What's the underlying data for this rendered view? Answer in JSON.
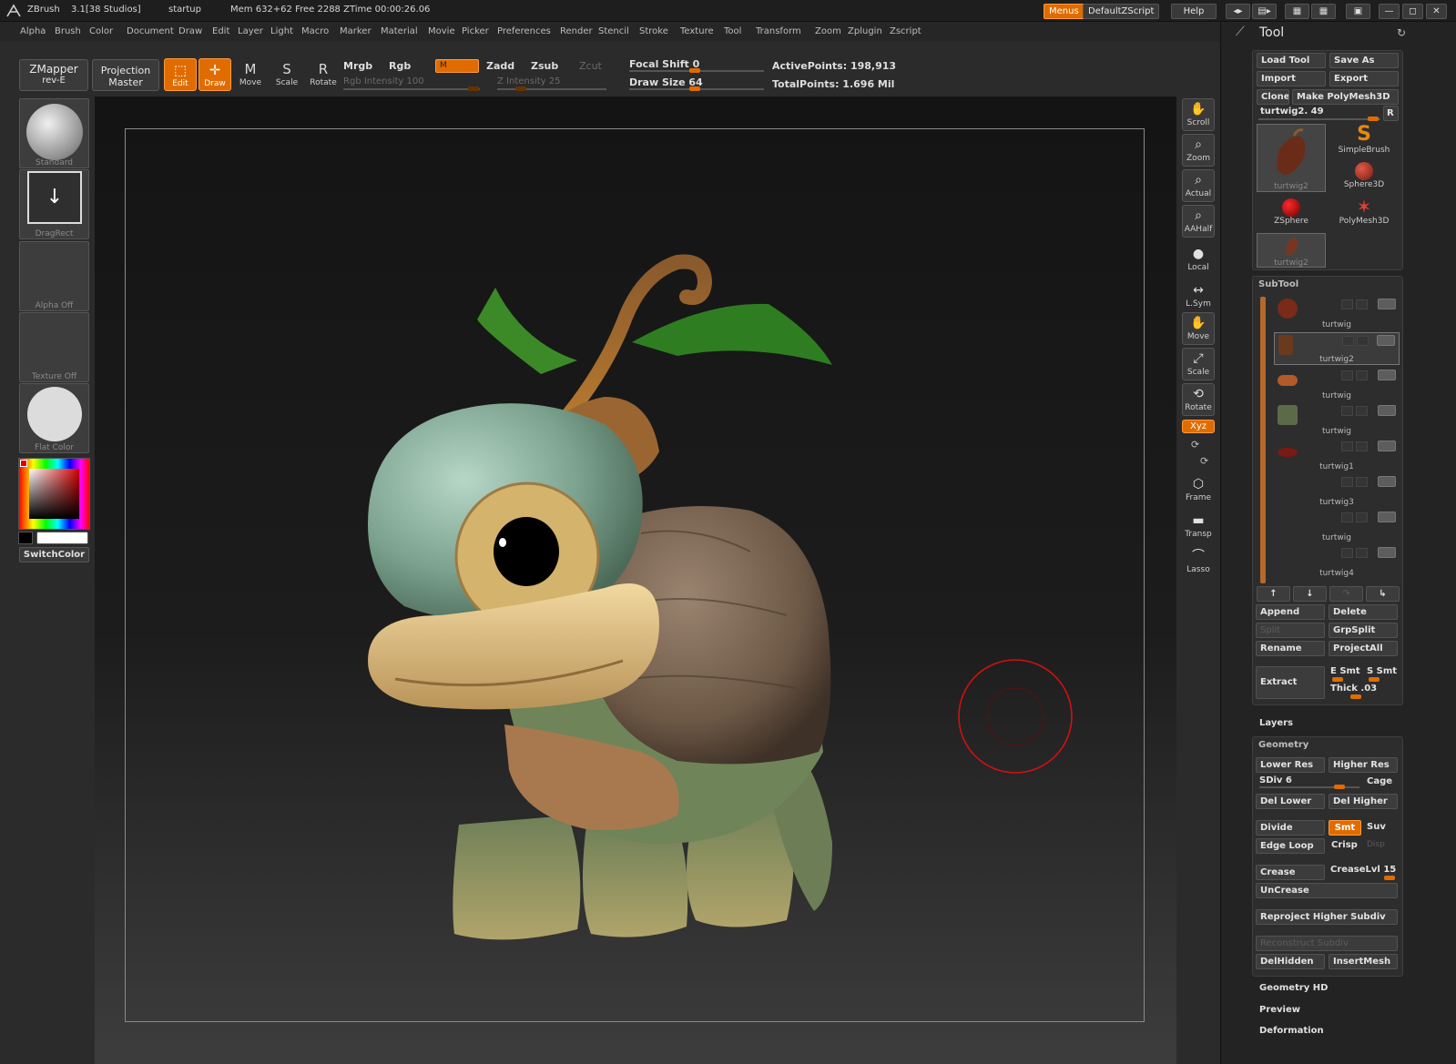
{
  "titlebar": {
    "app": "ZBrush",
    "version": "3.1[38 Studios]",
    "document": "startup",
    "memory": "Mem 632+62  Free 2288  ZTime 00:00:26.06",
    "menus_btn": "Menus",
    "script_btn": "DefaultZScript",
    "help_btn": "Help"
  },
  "menubar": [
    "Alpha",
    "Brush",
    "Color",
    "Document",
    "Draw",
    "Edit",
    "Layer",
    "Light",
    "Macro",
    "Marker",
    "Material",
    "Movie",
    "Picker",
    "Preferences",
    "Render",
    "Stencil",
    "Stroke",
    "Texture",
    "Tool",
    "Transform",
    "Zoom",
    "Zplugin",
    "Zscript"
  ],
  "shelf": {
    "zmapper": "ZMapper",
    "zmapper_sub": "rev-E",
    "projection": "Projection",
    "projection_sub": "Master",
    "edit": "Edit",
    "draw": "Draw",
    "move": "Move",
    "scale": "Scale",
    "rotate": "Rotate",
    "mrgb": "Mrgb",
    "rgb": "Rgb",
    "m": "M",
    "zadd": "Zadd",
    "zsub": "Zsub",
    "zcut": "Zcut",
    "rgb_intensity": "Rgb  Intensity 100",
    "z_intensity": "Z  Intensity 25",
    "focal_shift": "Focal Shift 0",
    "draw_size": "Draw Size 64",
    "active_points": "ActivePoints: 198,913",
    "total_points": "TotalPoints: 1.696  Mil"
  },
  "lefttray": {
    "brush": "Standard",
    "stroke": "DragRect",
    "alpha": "Alpha  Off",
    "texture": "Texture  Off",
    "material": "Flat Color",
    "switch": "SwitchColor"
  },
  "rightcol": [
    "Scroll",
    "Zoom",
    "Actual",
    "AAHalf",
    "Local",
    "L.Sym",
    "Move",
    "Scale",
    "Rotate",
    "Xyz",
    "Frame",
    "Transp",
    "Lasso"
  ],
  "panel": {
    "title": "Tool",
    "load_tool": "Load Tool",
    "save_as": "Save As",
    "import": "Import",
    "export": "Export",
    "clone": "Clone",
    "make_polymesh": "Make PolyMesh3D",
    "current_tool": "turtwig2. 49",
    "r_btn": "R",
    "tools": [
      "turtwig2",
      "SimpleBrush",
      "Sphere3D",
      "ZSphere",
      "PolyMesh3D",
      "turtwig2"
    ],
    "subtool_title": "SubTool",
    "subtools": [
      "turtwig",
      "turtwig2",
      "turtwig",
      "turtwig",
      "turtwig1",
      "turtwig3",
      "turtwig",
      "turtwig4"
    ],
    "append": "Append",
    "delete": "Delete",
    "split": "Split",
    "grpsplit": "GrpSplit",
    "rename": "Rename",
    "projectall": "ProjectAll",
    "extract": "Extract",
    "e_smt": "E Smt",
    "s_smt": "S Smt",
    "thick": "Thick .03",
    "layers": "Layers",
    "geometry": "Geometry",
    "lower_res": "Lower Res",
    "higher_res": "Higher Res",
    "sdiv": "SDiv 6",
    "cage": "Cage",
    "del_lower": "Del Lower",
    "del_higher": "Del Higher",
    "divide": "Divide",
    "smt": "Smt",
    "suv": "Suv",
    "edge_loop": "Edge Loop",
    "crisp": "Crisp",
    "disp": "Disp",
    "crease": "Crease",
    "crease_lvl": "CreaseLvl 15",
    "uncrease": "UnCrease",
    "reproject": "Reproject Higher Subdiv",
    "reconstruct": "Reconstruct Subdiv",
    "delhidden": "DelHidden",
    "insertmesh": "InsertMesh",
    "geometry_hd": "Geometry HD",
    "preview": "Preview",
    "deformation": "Deformation"
  },
  "colors": {
    "accent": "#e06c00",
    "panel": "#2d2d2d",
    "viewport_top": "#141414"
  }
}
